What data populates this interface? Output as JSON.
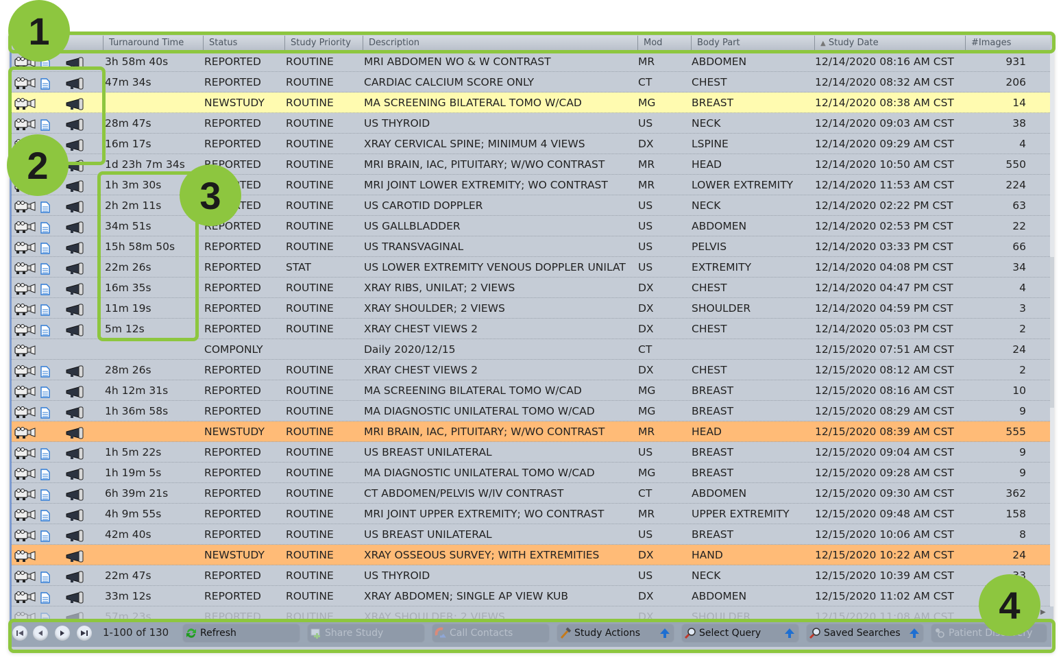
{
  "table": {
    "columns": [
      "",
      "Turnaround Time",
      "Status",
      "Study Priority",
      "Description",
      "Mod",
      "Body Part",
      "Study Date",
      "#Images"
    ],
    "sort_indicator": "▲",
    "sorted_column": "Study Date",
    "rows": [
      {
        "tat": "3h 58m 40s",
        "status": "REPORTED",
        "priority": "ROUTINE",
        "desc": "MRI ABDOMEN WO & W CONTRAST",
        "mod": "MR",
        "body": "ABDOMEN",
        "date": "12/14/2020 08:16 AM CST",
        "images": "931",
        "report": true,
        "highlight": ""
      },
      {
        "tat": "47m 34s",
        "status": "REPORTED",
        "priority": "ROUTINE",
        "desc": "CARDIAC CALCIUM SCORE ONLY",
        "mod": "CT",
        "body": "CHEST",
        "date": "12/14/2020 08:32 AM CST",
        "images": "206",
        "report": true,
        "highlight": ""
      },
      {
        "tat": "",
        "status": "NEWSTUDY",
        "priority": "ROUTINE",
        "desc": "MA SCREENING BILATERAL TOMO W/CAD",
        "mod": "MG",
        "body": "BREAST",
        "date": "12/14/2020 08:38 AM CST",
        "images": "14",
        "report": false,
        "highlight": "yellow"
      },
      {
        "tat": "28m 47s",
        "status": "REPORTED",
        "priority": "ROUTINE",
        "desc": "US THYROID",
        "mod": "US",
        "body": "NECK",
        "date": "12/14/2020 09:03 AM CST",
        "images": "38",
        "report": true,
        "highlight": ""
      },
      {
        "tat": "16m 17s",
        "status": "REPORTED",
        "priority": "ROUTINE",
        "desc": "XRAY CERVICAL SPINE; MINIMUM 4 VIEWS",
        "mod": "DX",
        "body": "LSPINE",
        "date": "12/14/2020 09:29 AM CST",
        "images": "4",
        "report": true,
        "highlight": ""
      },
      {
        "tat": "1d 23h 7m 34s",
        "status": "REPORTED",
        "priority": "ROUTINE",
        "desc": "MRI BRAIN, IAC, PITUITARY; W/WO CONTRAST",
        "mod": "MR",
        "body": "HEAD",
        "date": "12/14/2020 10:50 AM CST",
        "images": "550",
        "report": true,
        "highlight": ""
      },
      {
        "tat": "1h 3m 30s",
        "status": "REPORTED",
        "priority": "ROUTINE",
        "desc": "MRI JOINT LOWER EXTREMITY; WO CONTRAST",
        "mod": "MR",
        "body": "LOWER EXTREMITY",
        "date": "12/14/2020 11:53 AM CST",
        "images": "224",
        "report": true,
        "highlight": ""
      },
      {
        "tat": "2h 2m 11s",
        "status": "REPORTED",
        "priority": "ROUTINE",
        "desc": "US CAROTID DOPPLER",
        "mod": "US",
        "body": "NECK",
        "date": "12/14/2020 02:22 PM CST",
        "images": "63",
        "report": true,
        "highlight": ""
      },
      {
        "tat": "34m 51s",
        "status": "REPORTED",
        "priority": "ROUTINE",
        "desc": "US GALLBLADDER",
        "mod": "US",
        "body": "ABDOMEN",
        "date": "12/14/2020 02:53 PM CST",
        "images": "22",
        "report": true,
        "highlight": ""
      },
      {
        "tat": "15h 58m 50s",
        "status": "REPORTED",
        "priority": "ROUTINE",
        "desc": "US TRANSVAGINAL",
        "mod": "US",
        "body": "PELVIS",
        "date": "12/14/2020 03:33 PM CST",
        "images": "66",
        "report": true,
        "highlight": ""
      },
      {
        "tat": "22m 26s",
        "status": "REPORTED",
        "priority": "STAT",
        "desc": "US LOWER EXTREMITY VENOUS DOPPLER UNILAT",
        "mod": "US",
        "body": "EXTREMITY",
        "date": "12/14/2020 04:08 PM CST",
        "images": "34",
        "report": true,
        "highlight": ""
      },
      {
        "tat": "16m 35s",
        "status": "REPORTED",
        "priority": "ROUTINE",
        "desc": "XRAY RIBS, UNILAT; 2 VIEWS",
        "mod": "DX",
        "body": "CHEST",
        "date": "12/14/2020 04:47 PM CST",
        "images": "4",
        "report": true,
        "highlight": ""
      },
      {
        "tat": "11m 19s",
        "status": "REPORTED",
        "priority": "ROUTINE",
        "desc": "XRAY SHOULDER; 2 VIEWS",
        "mod": "DX",
        "body": "SHOULDER",
        "date": "12/14/2020 04:59 PM CST",
        "images": "3",
        "report": true,
        "highlight": ""
      },
      {
        "tat": "5m 12s",
        "status": "REPORTED",
        "priority": "ROUTINE",
        "desc": "XRAY CHEST VIEWS 2",
        "mod": "DX",
        "body": "CHEST",
        "date": "12/14/2020 05:03 PM CST",
        "images": "2",
        "report": true,
        "highlight": ""
      },
      {
        "tat": "",
        "status": "COMPONLY",
        "priority": "",
        "desc": "Daily 2020/12/15",
        "mod": "CT",
        "body": "",
        "date": "12/15/2020 07:51 AM CST",
        "images": "24",
        "report": false,
        "megaphone": false,
        "highlight": ""
      },
      {
        "tat": "28m 26s",
        "status": "REPORTED",
        "priority": "ROUTINE",
        "desc": "XRAY CHEST VIEWS 2",
        "mod": "DX",
        "body": "CHEST",
        "date": "12/15/2020 08:12 AM CST",
        "images": "2",
        "report": true,
        "highlight": ""
      },
      {
        "tat": "4h 12m 31s",
        "status": "REPORTED",
        "priority": "ROUTINE",
        "desc": "MA SCREENING BILATERAL TOMO W/CAD",
        "mod": "MG",
        "body": "BREAST",
        "date": "12/15/2020 08:16 AM CST",
        "images": "10",
        "report": true,
        "highlight": ""
      },
      {
        "tat": "1h 36m 58s",
        "status": "REPORTED",
        "priority": "ROUTINE",
        "desc": "MA DIAGNOSTIC UNILATERAL TOMO W/CAD",
        "mod": "MG",
        "body": "BREAST",
        "date": "12/15/2020 08:29 AM CST",
        "images": "9",
        "report": true,
        "highlight": ""
      },
      {
        "tat": "",
        "status": "NEWSTUDY",
        "priority": "ROUTINE",
        "desc": "MRI BRAIN, IAC, PITUITARY; W/WO CONTRAST",
        "mod": "MR",
        "body": "HEAD",
        "date": "12/15/2020 08:39 AM CST",
        "images": "555",
        "report": false,
        "highlight": "orange"
      },
      {
        "tat": "1h 5m 22s",
        "status": "REPORTED",
        "priority": "ROUTINE",
        "desc": "US BREAST UNILATERAL",
        "mod": "US",
        "body": "BREAST",
        "date": "12/15/2020 09:04 AM CST",
        "images": "9",
        "report": true,
        "highlight": ""
      },
      {
        "tat": "1h 19m 5s",
        "status": "REPORTED",
        "priority": "ROUTINE",
        "desc": "MA DIAGNOSTIC UNILATERAL TOMO W/CAD",
        "mod": "MG",
        "body": "BREAST",
        "date": "12/15/2020 09:28 AM CST",
        "images": "9",
        "report": true,
        "highlight": ""
      },
      {
        "tat": "6h 39m 21s",
        "status": "REPORTED",
        "priority": "ROUTINE",
        "desc": "CT ABDOMEN/PELVIS W/IV CONTRAST",
        "mod": "CT",
        "body": "ABDOMEN",
        "date": "12/15/2020 09:30 AM CST",
        "images": "362",
        "report": true,
        "highlight": ""
      },
      {
        "tat": "4h 9m 55s",
        "status": "REPORTED",
        "priority": "ROUTINE",
        "desc": "MRI JOINT UPPER EXTREMITY; WO CONTRAST",
        "mod": "MR",
        "body": "UPPER EXTREMITY",
        "date": "12/15/2020 09:48 AM CST",
        "images": "158",
        "report": true,
        "highlight": ""
      },
      {
        "tat": "42m 40s",
        "status": "REPORTED",
        "priority": "ROUTINE",
        "desc": "US BREAST UNILATERAL",
        "mod": "US",
        "body": "BREAST",
        "date": "12/15/2020 10:06 AM CST",
        "images": "8",
        "report": true,
        "highlight": ""
      },
      {
        "tat": "",
        "status": "NEWSTUDY",
        "priority": "ROUTINE",
        "desc": "XRAY OSSEOUS SURVEY; WITH EXTREMITIES",
        "mod": "DX",
        "body": "HAND",
        "date": "12/15/2020 10:22 AM CST",
        "images": "24",
        "report": false,
        "highlight": "orange"
      },
      {
        "tat": "22m 47s",
        "status": "REPORTED",
        "priority": "ROUTINE",
        "desc": "US THYROID",
        "mod": "US",
        "body": "NECK",
        "date": "12/15/2020 10:39 AM CST",
        "images": "33",
        "report": true,
        "highlight": ""
      },
      {
        "tat": "33m 12s",
        "status": "REPORTED",
        "priority": "ROUTINE",
        "desc": "XRAY ABDOMEN; SINGLE AP VIEW KUB",
        "mod": "DX",
        "body": "ABDOMEN",
        "date": "12/15/2020 11:02 AM CST",
        "images": "",
        "report": true,
        "highlight": ""
      },
      {
        "tat": "57m 23s",
        "status": "REPORTED",
        "priority": "ROUTINE",
        "desc": "XRAY SHOULDER; 2 VIEWS",
        "mod": "DX",
        "body": "SHOULDER",
        "date": "12/15/2020 11:08 AM CST",
        "images": "",
        "report": true,
        "highlight": "faded"
      }
    ]
  },
  "footer": {
    "pager_text": "1-100 of 130",
    "buttons": {
      "refresh": "Refresh",
      "share_study": "Share Study",
      "call_contacts": "Call Contacts",
      "study_actions": "Study Actions",
      "select_query": "Select Query",
      "saved_searches": "Saved Searches",
      "patient_discovery": "Patient Discovery"
    }
  },
  "annotations": [
    "1",
    "2",
    "3",
    "4"
  ],
  "colors": {
    "accent_green": "#8dc63f",
    "row_bg": "#c5ccd6",
    "highlight_yellow": "#fffbb0",
    "highlight_orange": "#ffbb77"
  }
}
